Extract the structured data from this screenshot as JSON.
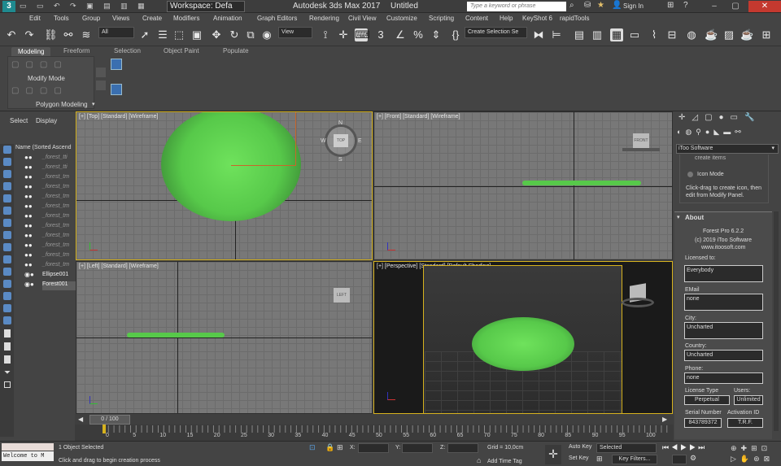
{
  "window": {
    "workspace_label": "Workspace: Defa",
    "app_title": "Autodesk 3ds Max 2017",
    "doc_title": "Untitled",
    "search_placeholder": "Type a keyword or phrase",
    "sign_in": "Sign In"
  },
  "menu": [
    "Edit",
    "Tools",
    "Group",
    "Views",
    "Create",
    "Modifiers",
    "Animation",
    "Graph Editors",
    "Rendering",
    "Civil View",
    "Customize",
    "Scripting",
    "Content",
    "Help",
    "KeyShot 6",
    "rapidTools"
  ],
  "toolbar": {
    "filter": "All",
    "view": "View",
    "selection_set": "Create Selection Se"
  },
  "ribbon": {
    "tabs": [
      "Modeling",
      "Freeform",
      "Selection",
      "Object Paint",
      "Populate"
    ],
    "modify_mode": "Modify Mode",
    "polygon_modeling": "Polygon Modeling"
  },
  "explorer": {
    "tabs": [
      "Select",
      "Display"
    ],
    "column_header": "Name (Sorted Ascend",
    "items": [
      "_forest_tti",
      "_forest_tti",
      "_forest_tm",
      "_forest_tm",
      "_forest_tm",
      "_forest_tm",
      "_forest_tm",
      "_forest_tm",
      "_forest_tm",
      "_forest_tm",
      "_forest_tm",
      "_forest_tm",
      "Ellipse001",
      "Forest001"
    ]
  },
  "viewports": {
    "top": "[+] [Top] [Standard] [Wireframe]",
    "front": "[+] [Front] [Standard] [Wireframe]",
    "left": "[+] [Left] [Standard] [Wireframe]",
    "persp": "[+] [Perspective] [Standard] [Default Shading]"
  },
  "viewcube": {
    "top": "TOP",
    "front": "FRONT",
    "left": "LEFT",
    "n": "N",
    "s": "S",
    "w": "W",
    "e": "E"
  },
  "cmdpanel": {
    "plugin_dropdown": "iToo Software",
    "create_items": "create items",
    "icon_mode": "Icon Mode",
    "instructions": "Click-drag to create icon, then edit from Modify Panel.",
    "about_header": "About",
    "product": "Forest Pro 6.2.2",
    "copyright": "(c) 2019 iToo Software",
    "website": "www.itoosoft.com",
    "licensed_to_label": "Licensed to:",
    "licensed_to": "Everybody",
    "email_label": "EMail",
    "email": "none",
    "city_label": "City:",
    "city": "Uncharted",
    "country_label": "Country:",
    "country": "Uncharted",
    "phone_label": "Phone:",
    "phone": "none",
    "license_type_label": "License Type",
    "license_type": "Perpetual",
    "users_label": "Users:",
    "users": "Unlimited",
    "serial_label": "Serial Number",
    "serial": "843789372",
    "activation_label": "Activation ID",
    "activation": "T.R.F."
  },
  "timeline": {
    "frame": "0 / 100",
    "ticks": [
      "0",
      "5",
      "10",
      "15",
      "20",
      "25",
      "30",
      "35",
      "40",
      "45",
      "50",
      "55",
      "60",
      "65",
      "70",
      "75",
      "80",
      "85",
      "90",
      "95",
      "100"
    ]
  },
  "status": {
    "welcome": "Welcome to M",
    "selected": "1 Object Selected",
    "prompt": "Click and drag to begin creation process",
    "x_label": "X:",
    "y_label": "Y:",
    "z_label": "Z:",
    "grid": "Grid = 10,0cm",
    "add_time_tag": "Add Time Tag",
    "auto_key": "Auto Key",
    "set_key": "Set Key",
    "selected_dd": "Selected",
    "key_filters": "Key Filters..."
  },
  "colors": {
    "foliage": "#5ccf4a",
    "viewport_active": "#d6b21e",
    "accent": "#5a8ac4"
  }
}
